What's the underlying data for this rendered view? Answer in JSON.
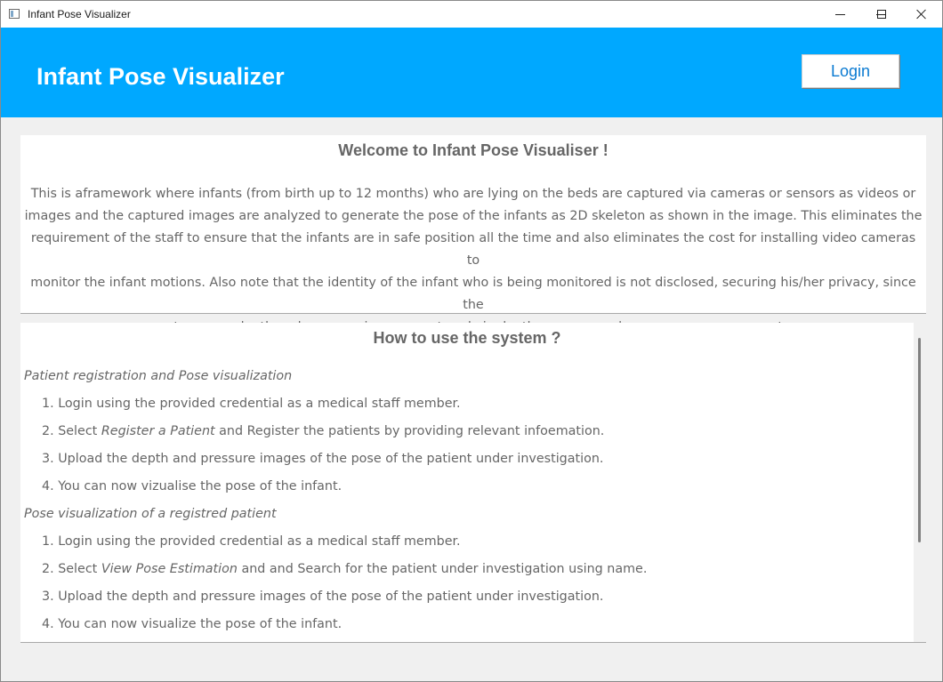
{
  "window": {
    "title": "Infant Pose Visualizer"
  },
  "header": {
    "title": "Infant Pose Visualizer",
    "login_label": "Login",
    "background": "#00a8ff"
  },
  "welcome": {
    "title": "Welcome to Infant Pose Visualiser !",
    "body_lines": [
      "This is aframework where infants (from birth up to 12 months) who are lying on the beds are captured via cameras or sensors as videos or",
      "images and the captured images are analyzed to generate the pose of the infants as 2D skeleton as shown in the image. This eliminates the",
      "requirement of the staff to ensure that the infants are in safe position all the time and also eliminates the cost for installing video cameras to",
      "monitor the infant motions. Also note that the identity of the infant who is being monitored is not disclosed, securing his/her privacy, since the",
      "system uses depth and pressure images captured via depth cameras and sensors on pressure mats."
    ]
  },
  "howto": {
    "title": "How to use the system ?",
    "sections": [
      {
        "heading": "Patient registration and Pose visualization",
        "steps": [
          {
            "num": "1.",
            "pre": "Login using the provided credential as a medical staff member.",
            "em": "",
            "post": ""
          },
          {
            "num": "2.",
            "pre": "Select ",
            "em": "Register a Patient",
            "post": " and Register the patients by providing relevant infoemation."
          },
          {
            "num": "3.",
            "pre": "Upload the depth and pressure images of the pose of the patient under investigation.",
            "em": "",
            "post": ""
          },
          {
            "num": "4.",
            "pre": "You can now vizualise the pose of the infant.",
            "em": "",
            "post": ""
          }
        ]
      },
      {
        "heading": "Pose visualization of a registred patient",
        "steps": [
          {
            "num": "1.",
            "pre": "Login using the provided credential as a medical staff member.",
            "em": "",
            "post": ""
          },
          {
            "num": "2.",
            "pre": "Select ",
            "em": "View Pose Estimation",
            "post": " and  and Search for the patient under investigation using name."
          },
          {
            "num": "3.",
            "pre": "Upload the depth and pressure images of the pose of the patient under investigation.",
            "em": "",
            "post": ""
          },
          {
            "num": "4.",
            "pre": "You can now visualize the pose of the infant.",
            "em": "",
            "post": ""
          }
        ]
      }
    ]
  }
}
